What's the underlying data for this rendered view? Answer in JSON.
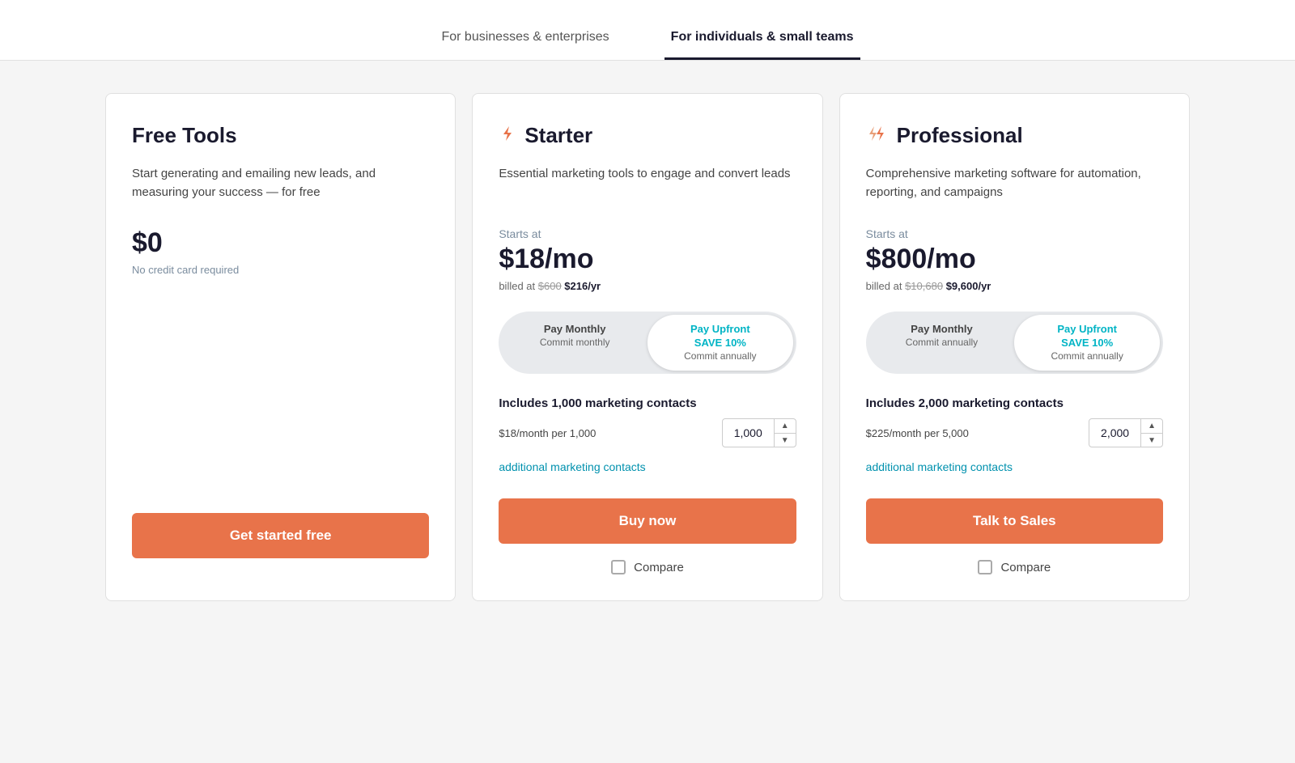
{
  "tabs": [
    {
      "id": "businesses",
      "label": "For businesses & enterprises",
      "active": false
    },
    {
      "id": "individuals",
      "label": "For individuals & small teams",
      "active": true
    }
  ],
  "cards": [
    {
      "id": "free",
      "icon": null,
      "title": "Free Tools",
      "description": "Start generating and emailing new leads, and measuring your success — for free",
      "starts_at_label": null,
      "price": "$0",
      "price_suffix": "",
      "billing_note": null,
      "billing_old": null,
      "no_cc": "No credit card required",
      "show_toggle": false,
      "includes_label": null,
      "contacts_price": null,
      "contacts_value": null,
      "cta_label": "Get started free",
      "show_compare": false
    },
    {
      "id": "starter",
      "icon": "lightning",
      "title": "Starter",
      "description": "Essential marketing tools to engage and convert leads",
      "starts_at_label": "Starts at",
      "price": "$18/mo",
      "price_suffix": "",
      "billing_note": "$216/yr",
      "billing_old": "$600",
      "no_cc": null,
      "toggle": {
        "monthly_label": "Pay Monthly",
        "monthly_sub": "Commit monthly",
        "upfront_label": "Pay Upfront",
        "upfront_save": "SAVE 10%",
        "upfront_sub": "Commit annually",
        "active": "upfront"
      },
      "includes_label": "Includes 1,000 marketing contacts",
      "contacts_price": "$18/month per 1,000",
      "contacts_value": "1,000",
      "additional_link": "additional marketing contacts",
      "cta_label": "Buy now",
      "show_compare": true,
      "compare_label": "Compare"
    },
    {
      "id": "professional",
      "icon": "lightning-double",
      "title": "Professional",
      "description": "Comprehensive marketing software for automation, reporting, and campaigns",
      "starts_at_label": "Starts at",
      "price": "$800/mo",
      "price_suffix": "",
      "billing_note": "$9,600/yr",
      "billing_old": "$10,680",
      "no_cc": null,
      "toggle": {
        "monthly_label": "Pay Monthly",
        "monthly_sub": "Commit annually",
        "upfront_label": "Pay Upfront",
        "upfront_save": "SAVE 10%",
        "upfront_sub": "Commit annually",
        "active": "upfront"
      },
      "includes_label": "Includes 2,000 marketing contacts",
      "contacts_price": "$225/month per 5,000",
      "contacts_value": "2,000",
      "additional_link": "additional marketing contacts",
      "cta_label": "Talk to Sales",
      "show_compare": true,
      "compare_label": "Compare"
    }
  ],
  "icons": {
    "lightning_color": "#e8734a",
    "chevron_up": "▲",
    "chevron_down": "▼"
  }
}
